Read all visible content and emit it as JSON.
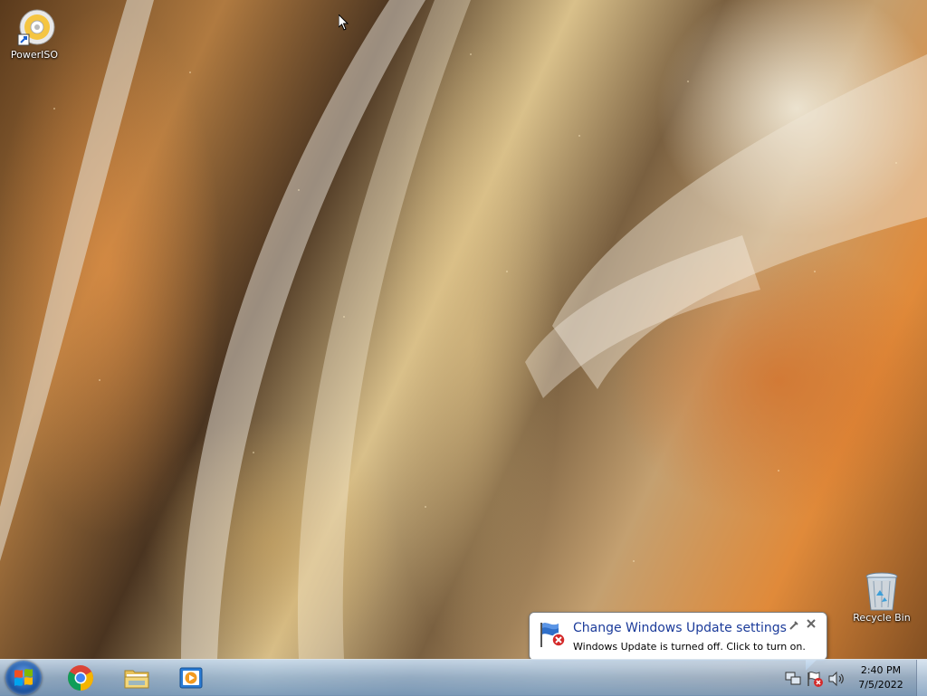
{
  "desktop": {
    "icons": [
      {
        "label": "PowerISO",
        "icon": "poweriso-disc-icon"
      },
      {
        "label": "Recycle Bin",
        "icon": "recycle-bin-icon"
      }
    ]
  },
  "notification": {
    "title": "Change Windows Update settings",
    "message": "Windows Update is turned off. Click to turn on.",
    "icon": "windows-update-flag-error-icon"
  },
  "taskbar": {
    "start": {
      "icon": "windows-start-orb-icon"
    },
    "pinned_apps": [
      {
        "name": "Google Chrome",
        "icon": "chrome-icon"
      },
      {
        "name": "Windows Explorer",
        "icon": "folder-icon"
      },
      {
        "name": "Windows Media Player",
        "icon": "media-player-icon"
      }
    ],
    "tray": {
      "icons": [
        "network-icon",
        "action-center-error-icon",
        "volume-icon"
      ],
      "time": "2:40 PM",
      "date": "7/5/2022"
    }
  }
}
